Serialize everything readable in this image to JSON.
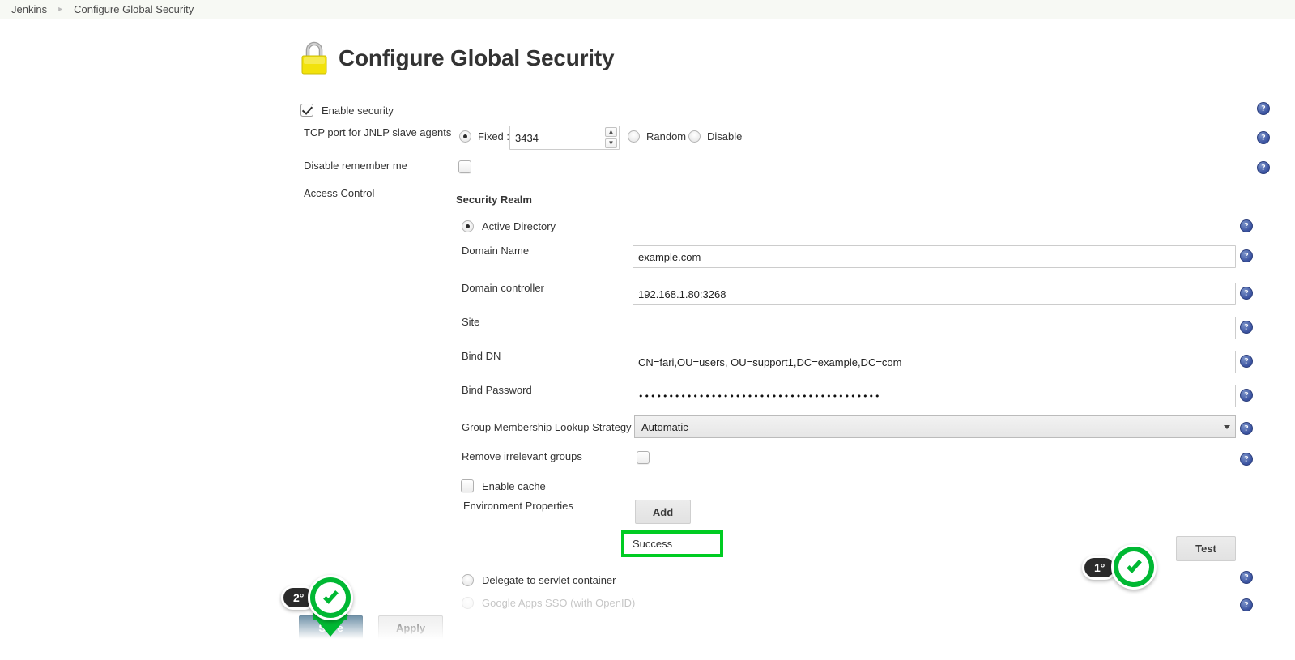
{
  "breadcrumb": {
    "root": "Jenkins",
    "separator": "▸",
    "current": "Configure Global Security"
  },
  "page": {
    "title": "Configure Global Security",
    "icon": "padlock-icon"
  },
  "form": {
    "enable_security": {
      "label": "Enable security",
      "checked": true
    },
    "tcp_port": {
      "label": "TCP port for JNLP slave agents",
      "fixed_label": "Fixed :",
      "fixed_selected": true,
      "value": "3434",
      "random_label": "Random",
      "random_selected": false,
      "disable_label": "Disable",
      "disable_selected": false,
      "spin_up": "▲",
      "spin_down": "▼"
    },
    "disable_remember_me": {
      "label": "Disable remember me",
      "checked": false
    },
    "access_control": {
      "label": "Access Control"
    }
  },
  "security_realm": {
    "title": "Security Realm",
    "active_directory": {
      "label": "Active Directory",
      "selected": true
    },
    "fields": [
      {
        "label": "Domain Name",
        "value": "example.com",
        "placeholder": ""
      },
      {
        "label": "Domain controller",
        "value": "192.168.1.80:3268",
        "placeholder": ""
      },
      {
        "label": "Site",
        "value": "",
        "placeholder": ""
      },
      {
        "label": "Bind DN",
        "value": "CN=fari,OU=users, OU=support1,DC=example,DC=com",
        "placeholder": ""
      }
    ],
    "bind_password": {
      "label": "Bind Password",
      "value": "••••••••••••••••••••••••••••••••••••••••"
    },
    "lookup_strategy": {
      "label": "Group Membership Lookup Strategy",
      "selected": "Automatic",
      "options": [
        "Automatic"
      ]
    },
    "remove_irrelevant_groups": {
      "label": "Remove irrelevant groups",
      "checked": false
    },
    "enable_cache": {
      "label": "Enable cache",
      "checked": false
    },
    "environment_properties": {
      "label": "Environment Properties",
      "add_button": "Add"
    },
    "test_button": "Test",
    "test_result": "Success",
    "delegate_servlet": {
      "label": "Delegate to servlet container",
      "selected": false
    },
    "google_sso": {
      "label": "Google Apps SSO (with OpenID)",
      "selected": false
    }
  },
  "footer": {
    "save_label": "Save",
    "apply_label": "Apply"
  },
  "annotations": [
    {
      "step": "1°",
      "target": "test-button",
      "direction": "right"
    },
    {
      "step": "2°",
      "target": "save-button",
      "direction": "down"
    }
  ],
  "help_icon": "?",
  "colors": {
    "accent_green": "#00b833",
    "highlight_green": "#00cc22",
    "save_blue": "#4c7693",
    "badge_dark": "#2b2b2b",
    "help_blue": "#3a52a0",
    "breadcrumb_bg": "#f7f9f4"
  }
}
